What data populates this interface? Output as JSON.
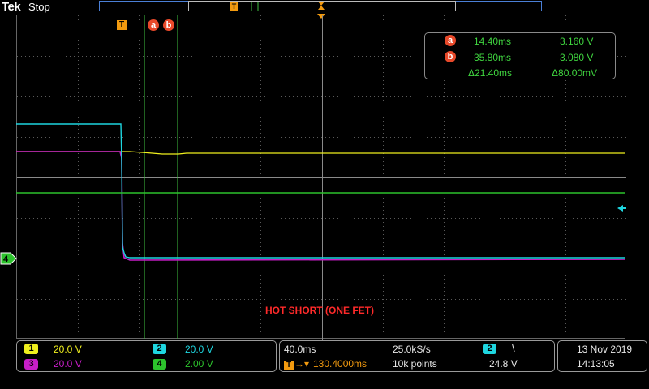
{
  "header": {
    "logo": "Tek",
    "status": "Stop"
  },
  "screen": {
    "trigger_marker": "T",
    "record_trigger_marker": "T",
    "cursor_a_label": "a",
    "cursor_b_label": "b",
    "annotation": "HOT SHORT (ONE FET)"
  },
  "cursor_readout": {
    "a": {
      "label": "a",
      "time": "14.40ms",
      "value": "3.160 V"
    },
    "b": {
      "label": "b",
      "time": "35.80ms",
      "value": "3.080 V"
    },
    "delta_time": "Δ21.40ms",
    "delta_value": "Δ80.00mV"
  },
  "channels": [
    {
      "id": "1",
      "scale": "20.0 V",
      "color": "#f0f01e"
    },
    {
      "id": "2",
      "scale": "20.0 V",
      "color": "#1ed6e0"
    },
    {
      "id": "3",
      "scale": "20.0 V",
      "color": "#c81ec8"
    },
    {
      "id": "4",
      "scale": "2.00 V",
      "color": "#2cc22c"
    }
  ],
  "ch4_ground_marker": "4",
  "timebase": {
    "scale": "40.0ms",
    "sample_rate": "25.0kS/s",
    "trigger_pos": "130.4000ms",
    "record_length": "10k points"
  },
  "trigger": {
    "source": "2",
    "slope_symbol": "\\",
    "level": "24.8 V"
  },
  "datetime": {
    "date": "13 Nov 2019",
    "time": "14:13:05"
  },
  "colors": {
    "trigger_orange": "#f29a0f",
    "cursor_line": "#3fc23f",
    "grid": "#5a5a5a",
    "annotation_red": "#ff2a2a"
  }
}
